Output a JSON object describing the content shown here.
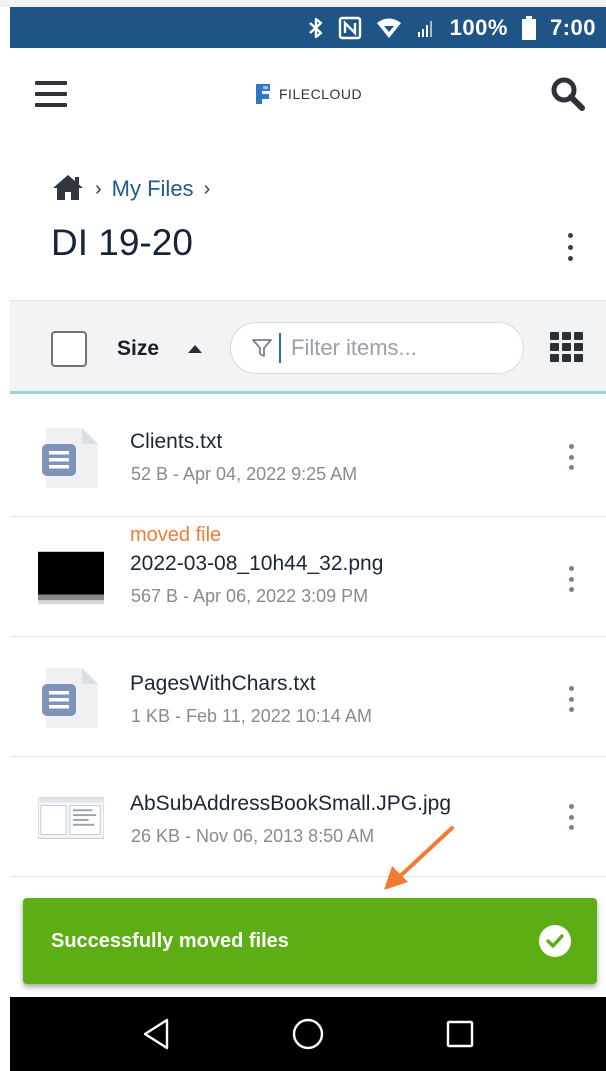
{
  "status_bar": {
    "battery": "100%",
    "time": "7:00",
    "icons": [
      "bluetooth-icon",
      "nfc-icon",
      "wifi-icon",
      "signal-icon",
      "battery-icon"
    ]
  },
  "app_bar": {
    "logo_text": "FILECLOUD",
    "icons": [
      "hamburger-menu-icon",
      "search-icon"
    ]
  },
  "breadcrumb": {
    "items": [
      "My Files"
    ],
    "home_icon": "home-icon"
  },
  "folder": {
    "title": "DI 19-20"
  },
  "toolbar": {
    "sort_label": "Size",
    "sort_direction": "ascending",
    "filter_placeholder": "Filter items...",
    "icons": [
      "filter-icon",
      "grid-view-icon"
    ]
  },
  "files": [
    {
      "name": "Clients.txt",
      "meta": "52 B - Apr 04, 2022 9:25 AM",
      "note": "",
      "thumb": "text-file-icon"
    },
    {
      "name": "2022-03-08_10h44_32.png",
      "meta": "567 B - Apr 06, 2022 3:09 PM",
      "note": "moved file",
      "thumb": "image-thumbnail"
    },
    {
      "name": "PagesWithChars.txt",
      "meta": "1 KB - Feb 11, 2022 10:14 AM",
      "note": "",
      "thumb": "text-file-icon"
    },
    {
      "name": "AbSubAddressBookSmall.JPG.jpg",
      "meta": "26 KB - Nov 06, 2013 8:50 AM",
      "note": "",
      "thumb": "image-thumbnail"
    }
  ],
  "toast": {
    "message": "Successfully moved files",
    "icon": "check-circle-icon"
  },
  "colors": {
    "status_bar": "#1f5586",
    "link": "#1f5a8e",
    "note": "#f07c34",
    "toast": "#5cae14",
    "arrow": "#f07c34"
  },
  "nav_bar": {
    "icons": [
      "back-icon",
      "home-circle-icon",
      "recents-icon"
    ]
  }
}
